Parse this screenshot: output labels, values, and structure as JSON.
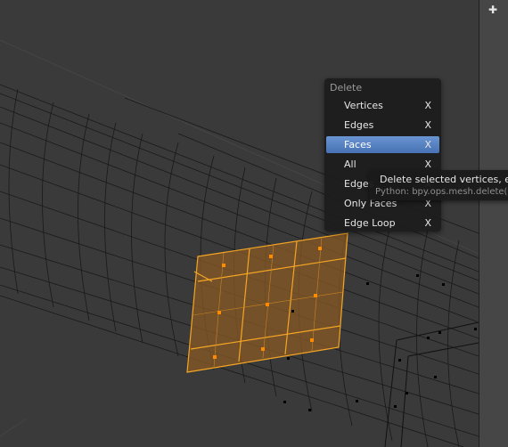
{
  "menu": {
    "title": "Delete",
    "items": [
      {
        "label": "Vertices",
        "key": "X"
      },
      {
        "label": "Edges",
        "key": "X"
      },
      {
        "label": "Faces",
        "key": "X"
      },
      {
        "label": "All",
        "key": "X"
      },
      {
        "label": "Edges",
        "key": "X"
      },
      {
        "label": "Only Faces",
        "key": "X"
      },
      {
        "label": "Edge Loop",
        "key": "X"
      }
    ],
    "active_item": "Faces"
  },
  "tooltip": {
    "description": "Delete selected vertices, edg",
    "python": "Python: bpy.ops.mesh.delete(t"
  },
  "colors": {
    "viewport_bg": "#3a3a3a",
    "wire": "#141414",
    "selection": "#f5a623",
    "selected_face_fill": "#8a5a25",
    "menu_highlight": "#5680c2"
  },
  "side_strip": {
    "icon": "plus-icon"
  }
}
